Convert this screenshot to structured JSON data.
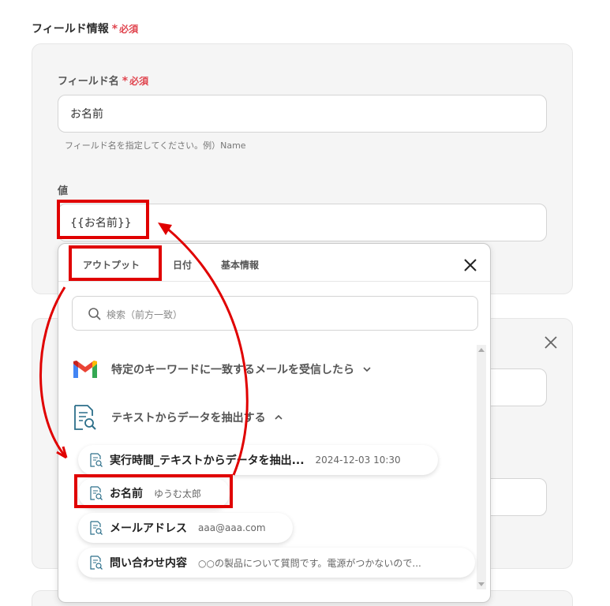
{
  "section": {
    "title": "フィールド情報",
    "required_label": "必須"
  },
  "field": {
    "name_label": "フィールド名",
    "required_label": "必須",
    "name_value": "お名前",
    "helper": "フィールド名を指定してください。例）Name",
    "value_label": "値",
    "value_value": "{{お名前}}"
  },
  "popup": {
    "tabs": [
      "アウトプット",
      "日付",
      "基本情報"
    ],
    "search_placeholder": "検索（前方一致）",
    "groups": [
      {
        "label": "特定のキーワードに一致するメールを受信したら",
        "icon": "gmail-icon",
        "expanded": false
      },
      {
        "label": "テキストからデータを抽出する",
        "icon": "document-search-icon",
        "expanded": true
      }
    ],
    "items": [
      {
        "name": "実行時間_テキストからデータを抽出...",
        "value": "2024-12-03 10:30"
      },
      {
        "name": "お名前",
        "value": "ゆうむ太郎"
      },
      {
        "name": "メールアドレス",
        "value": "aaa@aaa.com"
      },
      {
        "name": "問い合わせ内容",
        "value": "○○の製品について質問です。電源がつかないので..."
      }
    ]
  },
  "colors": {
    "required": "#e0454f",
    "annotation": "#e00000",
    "card_bg": "#f5f5f5"
  }
}
